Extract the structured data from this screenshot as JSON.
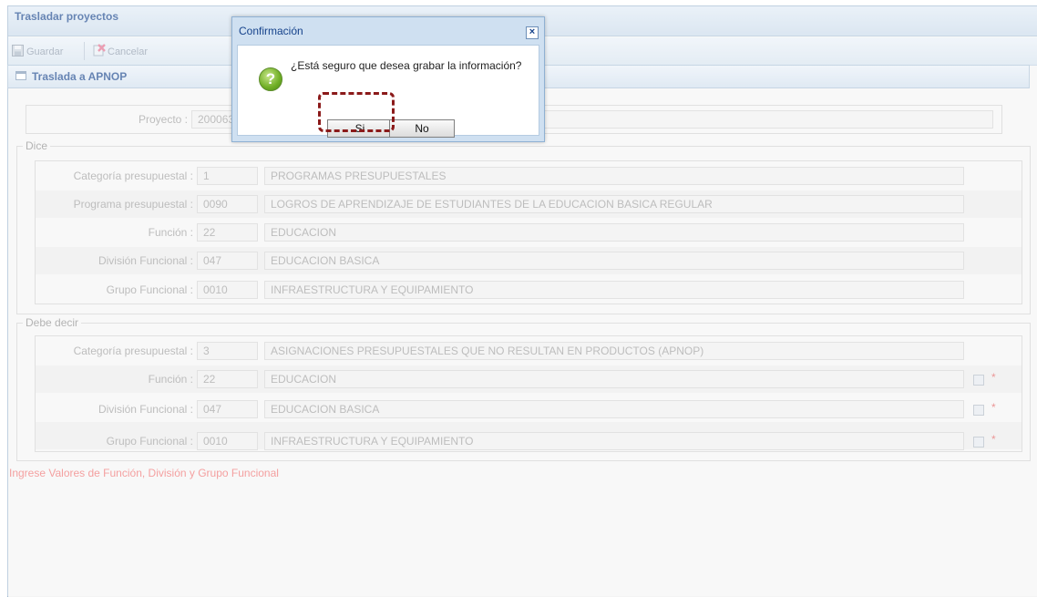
{
  "window": {
    "title": "Trasladar proyectos"
  },
  "toolbar": {
    "save_label": "Guardar",
    "cancel_label": "Cancelar"
  },
  "panel": {
    "title": "Traslada a APNOP"
  },
  "project": {
    "label": "Proyecto :",
    "value": "200063"
  },
  "dice": {
    "legend": "Dice",
    "rows": [
      {
        "label": "Categoría presupuestal :",
        "code": "1",
        "description": "PROGRAMAS PRESUPUESTALES"
      },
      {
        "label": "Programa presupuestal :",
        "code": "0090",
        "description": "LOGROS DE APRENDIZAJE DE ESTUDIANTES DE LA EDUCACION BASICA REGULAR"
      },
      {
        "label": "Función :",
        "code": "22",
        "description": "EDUCACION"
      },
      {
        "label": "División Funcional :",
        "code": "047",
        "description": "EDUCACION BASICA"
      },
      {
        "label": "Grupo Funcional :",
        "code": "0010",
        "description": "INFRAESTRUCTURA Y EQUIPAMIENTO"
      }
    ]
  },
  "debe_decir": {
    "legend": "Debe decir",
    "rows": [
      {
        "label": "Categoría presupuestal :",
        "code": "3",
        "description": "ASIGNACIONES PRESUPUESTALES QUE NO RESULTAN EN PRODUCTOS (APNOP)"
      },
      {
        "label": "Función :",
        "code": "22",
        "description": "EDUCACION",
        "required": "*"
      },
      {
        "label": "División Funcional :",
        "code": "047",
        "description": "EDUCACION BASICA",
        "required": "*"
      },
      {
        "label": "Grupo Funcional :",
        "code": "0010",
        "description": "INFRAESTRUCTURA Y EQUIPAMIENTO",
        "required": "*"
      }
    ]
  },
  "warning": "Ingrese Valores de Función, División y Grupo Funcional",
  "dialog": {
    "title": "Confirmación",
    "close_label": "×",
    "icon": "question-icon",
    "icon_glyph": "?",
    "message": "¿Está seguro que desea grabar la información?",
    "yes_label": "Si",
    "no_label": "No"
  },
  "colors": {
    "title_text": "#15428b",
    "warning_text": "#ef6d6d",
    "highlight_border": "#8b1a1a",
    "question_icon": "#6fae24"
  }
}
